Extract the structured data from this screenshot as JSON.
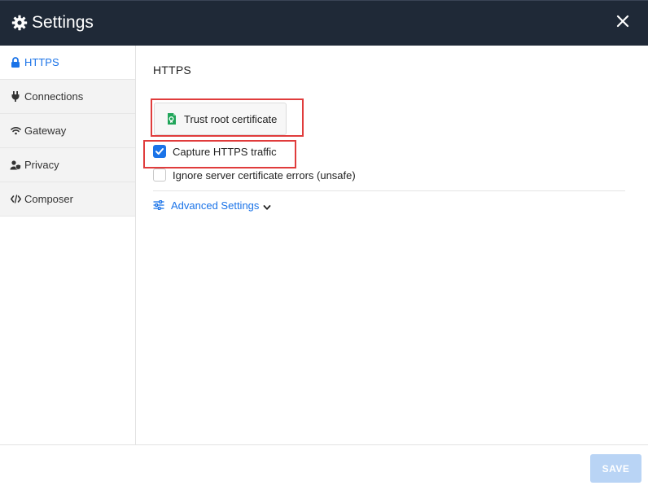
{
  "window": {
    "title": "Settings",
    "title_icon": "gear-icon",
    "close_icon": "close-icon"
  },
  "sidebar": {
    "items": [
      {
        "label": "HTTPS",
        "icon": "lock-icon",
        "active": true
      },
      {
        "label": "Connections",
        "icon": "plug-icon",
        "active": false
      },
      {
        "label": "Gateway",
        "icon": "wifi-icon",
        "active": false
      },
      {
        "label": "Privacy",
        "icon": "user-shield-icon",
        "active": false
      },
      {
        "label": "Composer",
        "icon": "code-icon",
        "active": false
      }
    ]
  },
  "main": {
    "section_title": "HTTPS",
    "trust_button": {
      "label": "Trust root certificate",
      "icon": "certificate-icon"
    },
    "options": [
      {
        "label": "Capture HTTPS traffic",
        "checked": true
      },
      {
        "label": "Ignore server certificate errors (unsafe)",
        "checked": false
      }
    ],
    "advanced": {
      "label": "Advanced Settings",
      "icon": "sliders-icon",
      "chevron": "chevron-down-icon"
    }
  },
  "footer": {
    "save_label": "SAVE"
  },
  "colors": {
    "titlebar": "#1f2937",
    "accent": "#1a73e8",
    "save_disabled": "#b9d4f5",
    "highlight": "#e03c3c",
    "cert_green": "#21a55a"
  }
}
